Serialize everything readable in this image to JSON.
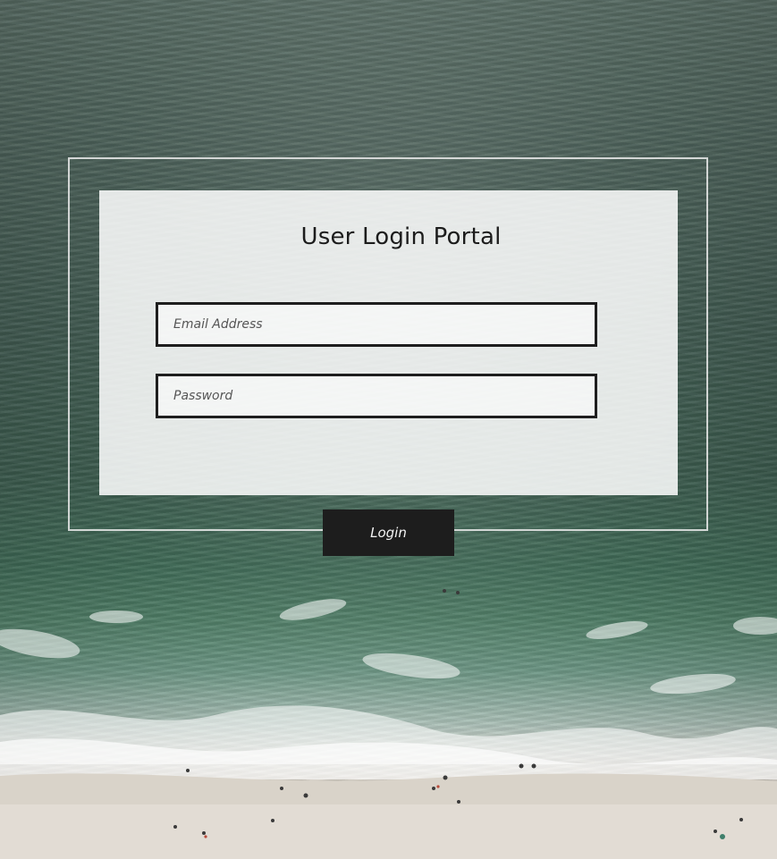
{
  "login": {
    "title": "User Login Portal",
    "email_placeholder": "Email Address",
    "email_value": "",
    "password_placeholder": "Password",
    "password_value": "",
    "button_label": "Login"
  },
  "colors": {
    "card_background": "#ffffff",
    "field_border": "#1e1e1e",
    "button_background": "#1d1d1d",
    "button_text": "#f4f4f4",
    "frame_border": "#ebebeb",
    "ocean": "#3f584f",
    "sand": "#e3dfd8"
  }
}
